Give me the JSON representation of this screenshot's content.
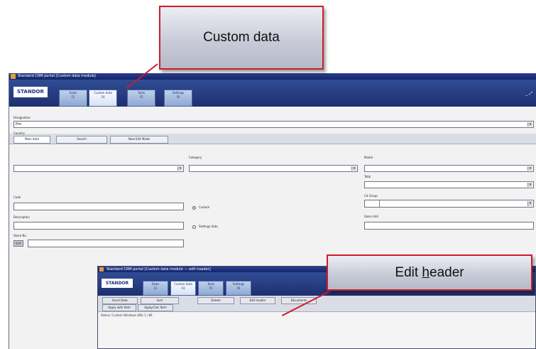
{
  "callouts": {
    "custom_data": "Custom data",
    "edit_header_prefix": "Edit ",
    "edit_header_accel": "h",
    "edit_header_suffix": "eader"
  },
  "main_window": {
    "title": "Standard CRM portal [Custom data module]",
    "logo": "STANDOR",
    "nav_tabs": [
      {
        "label": "Sales",
        "sub": "F2"
      },
      {
        "label": "Custom data",
        "sub": "F4"
      },
      {
        "label": "Tools",
        "sub": "F5"
      },
      {
        "label": "Settings",
        "sub": "F6"
      }
    ],
    "window_controls": "_ ⤢",
    "sub_tabs": [
      "Main data",
      "Search",
      "New Edit Mode"
    ],
    "form": {
      "designation_label": "Designation",
      "designation_value": "Pre",
      "country_label": "Country",
      "category_label": "Category",
      "model_label": "Model",
      "total_label": "Total",
      "code_label": "Code",
      "description_label": "Description",
      "stock_label": "Stock No.",
      "stock_chip": "EUR",
      "radio_1": "Custom",
      "radio_2": "Settings data",
      "cd_group_label": "Cd Group",
      "sales_unit_label": "Sales Unit"
    }
  },
  "second_window": {
    "title": "Standard CRM portal [Custom data module — edit header]",
    "logo": "STANDOR",
    "nav_tabs": [
      {
        "label": "Sales",
        "sub": "F2"
      },
      {
        "label": "Custom data",
        "sub": "F4"
      },
      {
        "label": "Tools",
        "sub": "F5"
      },
      {
        "label": "Settings",
        "sub": "F6"
      }
    ],
    "action_buttons": [
      "Excel Data",
      "Sort",
      "Delete",
      "Edit header",
      "Documents"
    ],
    "sub_buttons": [
      "Apply with Item",
      "Apply/Calc Item"
    ],
    "status": "Status: Custom Windows (EN)    1 / 86"
  }
}
